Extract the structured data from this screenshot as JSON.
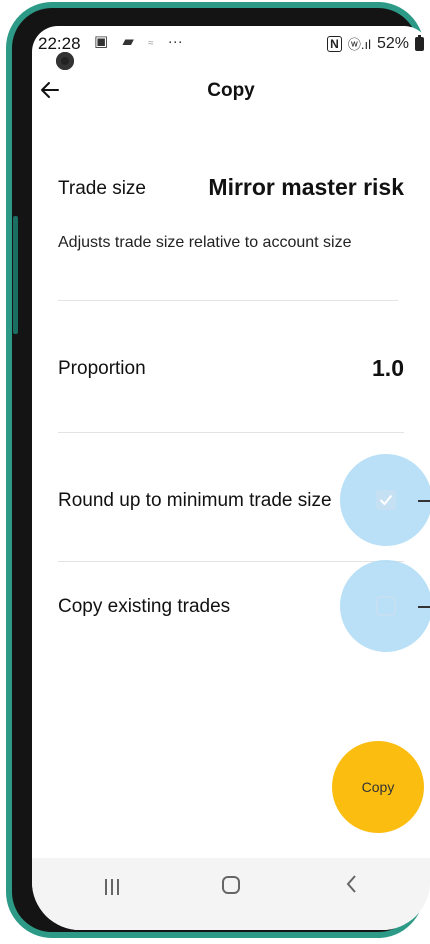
{
  "status_bar": {
    "time": "22:28",
    "left_icons": [
      "image-icon",
      "message-icon",
      "notification-icon",
      "more-icon"
    ],
    "more_text": "···",
    "nfc_text": "N",
    "signal_text": "ⓦ.ıl",
    "battery": "52%"
  },
  "header": {
    "title": "Copy"
  },
  "trade_size": {
    "label": "Trade size",
    "value": "Mirror master risk",
    "description": "Adjusts trade size relative to account size"
  },
  "proportion": {
    "label": "Proportion",
    "value": "1.0"
  },
  "options": [
    {
      "label": "Round up to minimum trade size",
      "checked": true
    },
    {
      "label": "Copy existing trades",
      "checked": false
    }
  ],
  "fab": {
    "label": "Copy"
  },
  "colors": {
    "frame": "#2c9a86",
    "fab": "#fbbd10",
    "ripple": "#addbf5"
  }
}
